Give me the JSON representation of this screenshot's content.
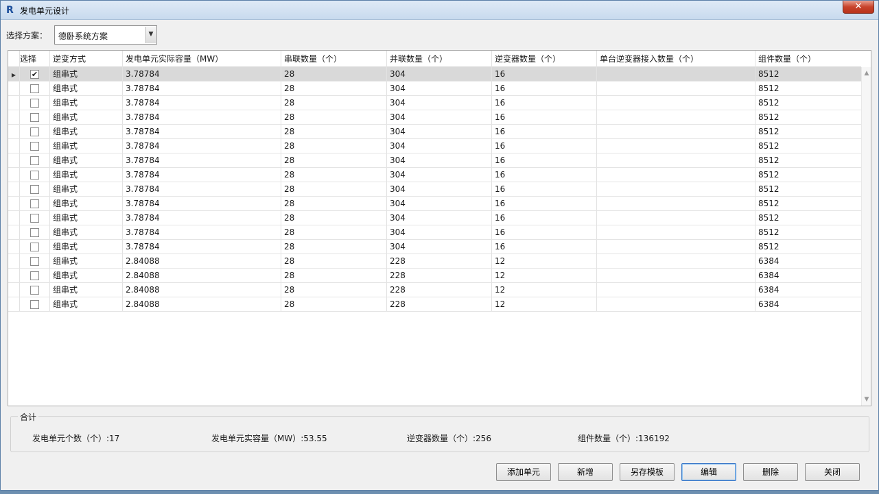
{
  "window": {
    "title": "发电单元设计",
    "close_symbol": "✕",
    "app_icon_letter": "R"
  },
  "scheme": {
    "label": "选择方案：",
    "value": "德卧系统方案"
  },
  "table": {
    "columns": [
      "选择",
      "逆变方式",
      "发电单元实际容量（MW）",
      "串联数量（个）",
      "并联数量（个）",
      "逆变器数量（个）",
      "单台逆变器接入数量（个）",
      "组件数量（个）"
    ],
    "rows": [
      {
        "checked": true,
        "mode": "组串式",
        "capacity": "3.78784",
        "series": "28",
        "parallel": "304",
        "inverters": "16",
        "per_inverter": "",
        "modules": "8512"
      },
      {
        "checked": false,
        "mode": "组串式",
        "capacity": "3.78784",
        "series": "28",
        "parallel": "304",
        "inverters": "16",
        "per_inverter": "",
        "modules": "8512"
      },
      {
        "checked": false,
        "mode": "组串式",
        "capacity": "3.78784",
        "series": "28",
        "parallel": "304",
        "inverters": "16",
        "per_inverter": "",
        "modules": "8512"
      },
      {
        "checked": false,
        "mode": "组串式",
        "capacity": "3.78784",
        "series": "28",
        "parallel": "304",
        "inverters": "16",
        "per_inverter": "",
        "modules": "8512"
      },
      {
        "checked": false,
        "mode": "组串式",
        "capacity": "3.78784",
        "series": "28",
        "parallel": "304",
        "inverters": "16",
        "per_inverter": "",
        "modules": "8512"
      },
      {
        "checked": false,
        "mode": "组串式",
        "capacity": "3.78784",
        "series": "28",
        "parallel": "304",
        "inverters": "16",
        "per_inverter": "",
        "modules": "8512"
      },
      {
        "checked": false,
        "mode": "组串式",
        "capacity": "3.78784",
        "series": "28",
        "parallel": "304",
        "inverters": "16",
        "per_inverter": "",
        "modules": "8512"
      },
      {
        "checked": false,
        "mode": "组串式",
        "capacity": "3.78784",
        "series": "28",
        "parallel": "304",
        "inverters": "16",
        "per_inverter": "",
        "modules": "8512"
      },
      {
        "checked": false,
        "mode": "组串式",
        "capacity": "3.78784",
        "series": "28",
        "parallel": "304",
        "inverters": "16",
        "per_inverter": "",
        "modules": "8512"
      },
      {
        "checked": false,
        "mode": "组串式",
        "capacity": "3.78784",
        "series": "28",
        "parallel": "304",
        "inverters": "16",
        "per_inverter": "",
        "modules": "8512"
      },
      {
        "checked": false,
        "mode": "组串式",
        "capacity": "3.78784",
        "series": "28",
        "parallel": "304",
        "inverters": "16",
        "per_inverter": "",
        "modules": "8512"
      },
      {
        "checked": false,
        "mode": "组串式",
        "capacity": "3.78784",
        "series": "28",
        "parallel": "304",
        "inverters": "16",
        "per_inverter": "",
        "modules": "8512"
      },
      {
        "checked": false,
        "mode": "组串式",
        "capacity": "3.78784",
        "series": "28",
        "parallel": "304",
        "inverters": "16",
        "per_inverter": "",
        "modules": "8512"
      },
      {
        "checked": false,
        "mode": "组串式",
        "capacity": "2.84088",
        "series": "28",
        "parallel": "228",
        "inverters": "12",
        "per_inverter": "",
        "modules": "6384"
      },
      {
        "checked": false,
        "mode": "组串式",
        "capacity": "2.84088",
        "series": "28",
        "parallel": "228",
        "inverters": "12",
        "per_inverter": "",
        "modules": "6384"
      },
      {
        "checked": false,
        "mode": "组串式",
        "capacity": "2.84088",
        "series": "28",
        "parallel": "228",
        "inverters": "12",
        "per_inverter": "",
        "modules": "6384"
      },
      {
        "checked": false,
        "mode": "组串式",
        "capacity": "2.84088",
        "series": "28",
        "parallel": "228",
        "inverters": "12",
        "per_inverter": "",
        "modules": "6384"
      }
    ]
  },
  "summary": {
    "legend": "合计",
    "unit_count": "发电单元个数（个）:17",
    "capacity": "发电单元实容量（MW）:53.55",
    "inverters": "逆变器数量（个）:256",
    "modules": "组件数量（个）:136192"
  },
  "buttons": {
    "add_unit": "添加单元",
    "new": "新增",
    "save_template": "另存模板",
    "edit": "编辑",
    "delete": "删除",
    "close": "关闭"
  },
  "icons": {
    "dropdown": "dropdown-arrow-icon",
    "row_marker": "row-pointer-icon",
    "checkbox_checked": "checkmark-icon",
    "scroll_up": "scroll-up-icon",
    "scroll_down": "scroll-down-icon"
  },
  "colors": {
    "title_bar": "#c8daee",
    "close_button": "#c8442c",
    "selected_row": "#d9d9d9",
    "default_button_border": "#3a78c8"
  }
}
